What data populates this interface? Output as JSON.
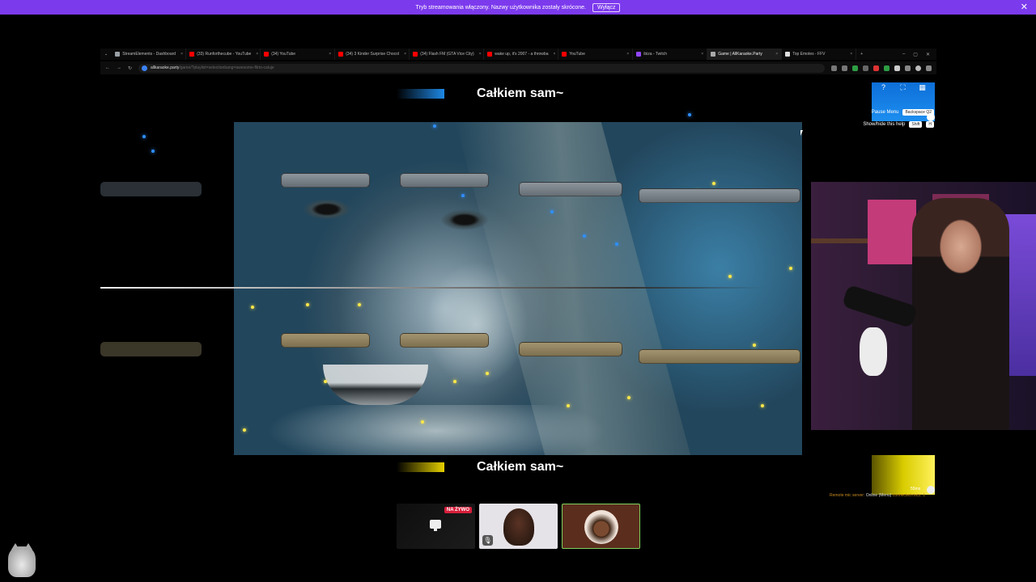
{
  "banner": {
    "text": "Tryb streamowania włączony. Nazwy użytkownika zostały skrócone.",
    "button": "Wyłącz",
    "close": "✕"
  },
  "browser": {
    "tabs": [
      {
        "label": "StreamElements - Dashboard",
        "color": "#9aa0a6"
      },
      {
        "label": "(33) Runforthecube - YouTube",
        "color": "#ff0000"
      },
      {
        "label": "(34) YouTube",
        "color": "#ff0000"
      },
      {
        "label": "(34) 3 Kinder Surprise Chocol",
        "color": "#ff0000"
      },
      {
        "label": "(34) Flash FM (GTA Vice City)",
        "color": "#ff0000"
      },
      {
        "label": "wake up, it's 2007 - a throwba",
        "color": "#ff0000"
      },
      {
        "label": "YouTube",
        "color": "#ff0000"
      },
      {
        "label": "ibiza - Twitch",
        "color": "#9146ff"
      },
      {
        "label": "Game | AllKaraoke.Party",
        "color": "#aaaaaa"
      },
      {
        "label": "Top Emotes - FFV",
        "color": "#dddddd"
      }
    ],
    "new_tab": "+",
    "url_host": "allkaraoke.party",
    "url_path": "/game/?playlist=selectionbang=awesome-flirto-caluje"
  },
  "karaoke": {
    "lyric_top": "Całkiem sam~",
    "lyric_bottom": "Całkiem sam~"
  },
  "help": {
    "pause_label": "Pause Menu",
    "pause_key": "Backspace  Q2",
    "toggle_label": "Show/hide this help",
    "toggle_key": "Shift",
    "toggle_key2": "H"
  },
  "volume": {
    "label": "55ms"
  },
  "remote": {
    "label": "Remote mic server:",
    "status": "Online (Menu)",
    "connected": "connected mics: 1"
  },
  "players": {
    "live_badge": "NA ŻYWO",
    "mute_icon": "🎙"
  }
}
